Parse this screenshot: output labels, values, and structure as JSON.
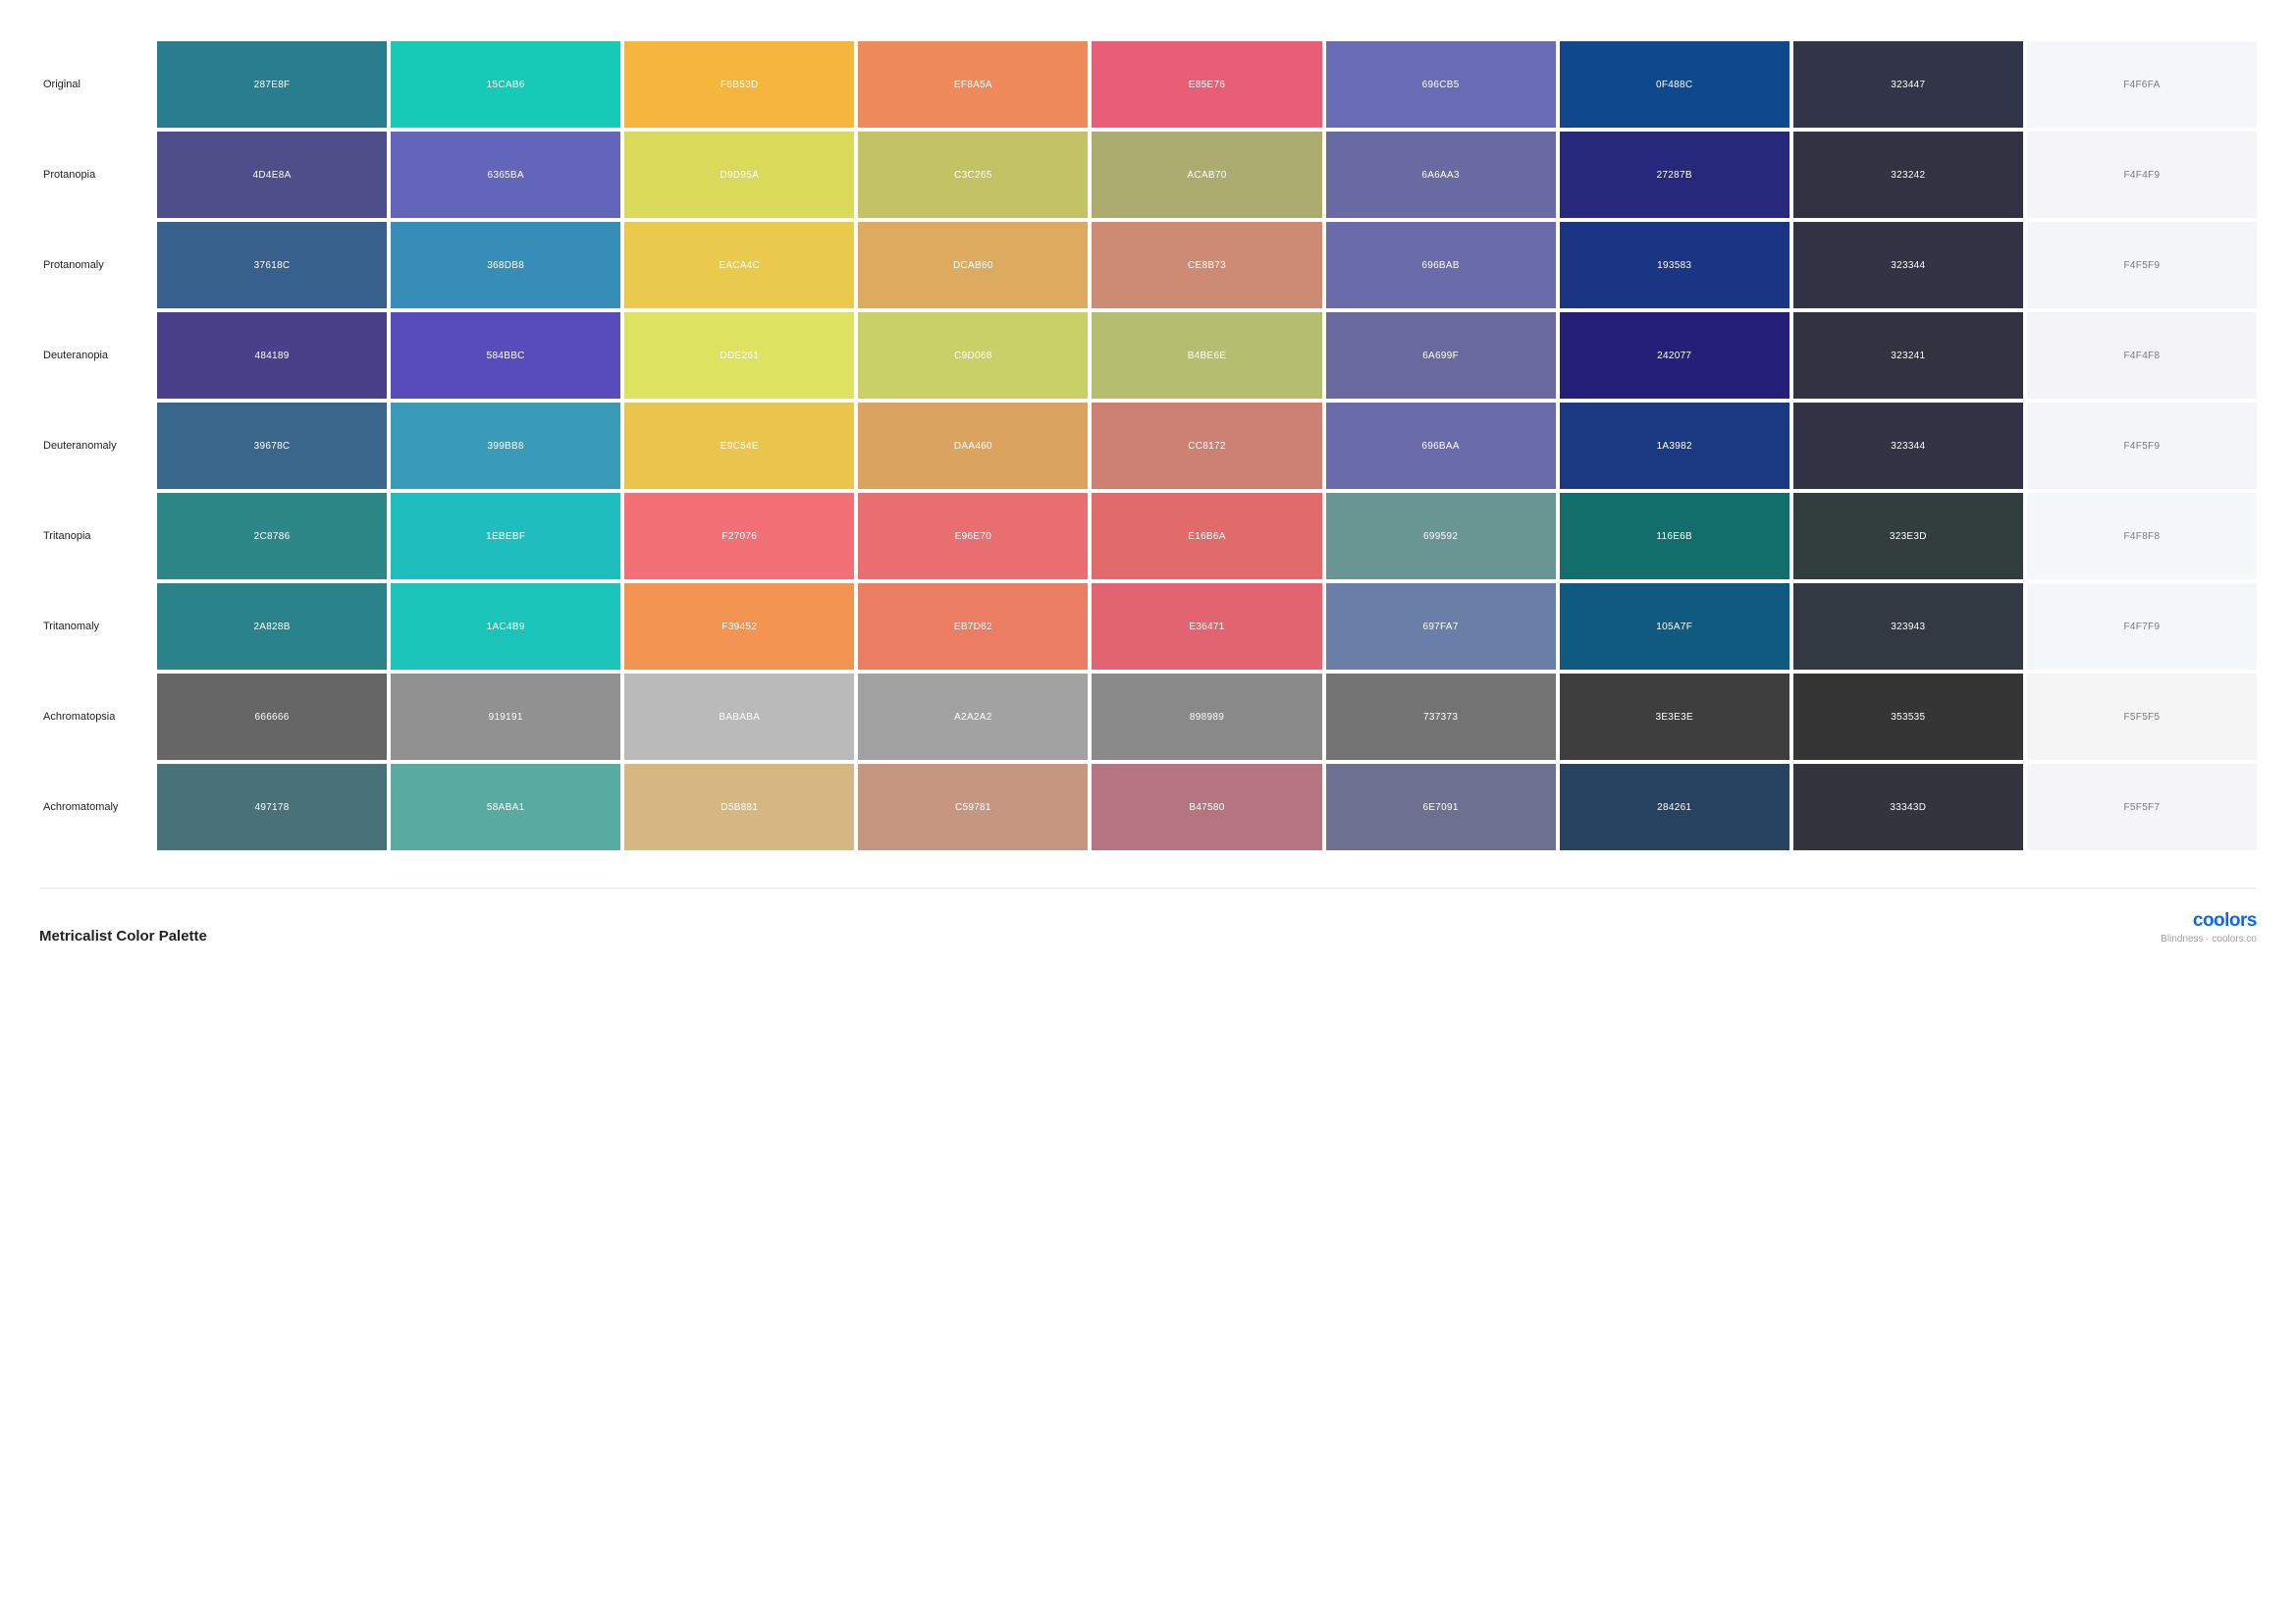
{
  "title": "Metricalist Color Palette",
  "brand": "coolors",
  "brand_sub": "Blindness · coolors.co",
  "rows": [
    {
      "label": "Original",
      "swatches": [
        {
          "hex": "287E8F",
          "text": "light"
        },
        {
          "hex": "15CAB6",
          "text": "light"
        },
        {
          "hex": "F6B53D",
          "text": "light"
        },
        {
          "hex": "EF8A5A",
          "text": "light"
        },
        {
          "hex": "E85E76",
          "text": "light"
        },
        {
          "hex": "696CB5",
          "text": "light"
        },
        {
          "hex": "0F488C",
          "text": "light"
        },
        {
          "hex": "323447",
          "text": "light"
        },
        {
          "hex": "F4F6FA",
          "text": "dark"
        }
      ]
    },
    {
      "label": "Protanopia",
      "swatches": [
        {
          "hex": "4D4E8A",
          "text": "light"
        },
        {
          "hex": "6365BA",
          "text": "light"
        },
        {
          "hex": "D9D95A",
          "text": "light"
        },
        {
          "hex": "C3C265",
          "text": "light"
        },
        {
          "hex": "ACAB70",
          "text": "light"
        },
        {
          "hex": "6A6AA3",
          "text": "light"
        },
        {
          "hex": "27287B",
          "text": "light"
        },
        {
          "hex": "323242",
          "text": "light"
        },
        {
          "hex": "F4F4F9",
          "text": "dark"
        }
      ]
    },
    {
      "label": "Protanomaly",
      "swatches": [
        {
          "hex": "37618C",
          "text": "light"
        },
        {
          "hex": "368DB8",
          "text": "light"
        },
        {
          "hex": "EACA4C",
          "text": "light"
        },
        {
          "hex": "DCAB60",
          "text": "light"
        },
        {
          "hex": "CE8B73",
          "text": "light"
        },
        {
          "hex": "696BAB",
          "text": "light"
        },
        {
          "hex": "193583",
          "text": "light"
        },
        {
          "hex": "323344",
          "text": "light"
        },
        {
          "hex": "F4F5F9",
          "text": "dark"
        }
      ]
    },
    {
      "label": "Deuteranopia",
      "swatches": [
        {
          "hex": "484189",
          "text": "light"
        },
        {
          "hex": "584BBC",
          "text": "light"
        },
        {
          "hex": "DDE261",
          "text": "light"
        },
        {
          "hex": "C9D068",
          "text": "light"
        },
        {
          "hex": "B4BE6E",
          "text": "light"
        },
        {
          "hex": "6A699F",
          "text": "light"
        },
        {
          "hex": "242077",
          "text": "light"
        },
        {
          "hex": "323241",
          "text": "light"
        },
        {
          "hex": "F4F4F8",
          "text": "dark"
        }
      ]
    },
    {
      "label": "Deuteranomaly",
      "swatches": [
        {
          "hex": "39678C",
          "text": "light"
        },
        {
          "hex": "399BB8",
          "text": "light"
        },
        {
          "hex": "E9C54E",
          "text": "light"
        },
        {
          "hex": "DAA460",
          "text": "light"
        },
        {
          "hex": "CC8172",
          "text": "light"
        },
        {
          "hex": "696BAA",
          "text": "light"
        },
        {
          "hex": "1A3982",
          "text": "light"
        },
        {
          "hex": "323344",
          "text": "light"
        },
        {
          "hex": "F4F5F9",
          "text": "dark"
        }
      ]
    },
    {
      "label": "Tritanopia",
      "swatches": [
        {
          "hex": "2C8786",
          "text": "light"
        },
        {
          "hex": "1EBEBF",
          "text": "light"
        },
        {
          "hex": "F27076",
          "text": "light"
        },
        {
          "hex": "E96E70",
          "text": "light"
        },
        {
          "hex": "E16B6A",
          "text": "light"
        },
        {
          "hex": "699592",
          "text": "light"
        },
        {
          "hex": "116E6B",
          "text": "light"
        },
        {
          "hex": "323E3D",
          "text": "light"
        },
        {
          "hex": "F4F8F8",
          "text": "dark"
        }
      ]
    },
    {
      "label": "Tritanomaly",
      "swatches": [
        {
          "hex": "2A828B",
          "text": "light"
        },
        {
          "hex": "1AC4B9",
          "text": "light"
        },
        {
          "hex": "F39452",
          "text": "light"
        },
        {
          "hex": "EB7D62",
          "text": "light"
        },
        {
          "hex": "E36471",
          "text": "light"
        },
        {
          "hex": "697FA7",
          "text": "light"
        },
        {
          "hex": "105A7F",
          "text": "light"
        },
        {
          "hex": "323943",
          "text": "light"
        },
        {
          "hex": "F4F7F9",
          "text": "dark"
        }
      ]
    },
    {
      "label": "Achromatopsia",
      "swatches": [
        {
          "hex": "666666",
          "text": "light"
        },
        {
          "hex": "919191",
          "text": "light"
        },
        {
          "hex": "BABABA",
          "text": "light"
        },
        {
          "hex": "A2A2A2",
          "text": "light"
        },
        {
          "hex": "898989",
          "text": "light"
        },
        {
          "hex": "737373",
          "text": "light"
        },
        {
          "hex": "3E3E3E",
          "text": "light"
        },
        {
          "hex": "353535",
          "text": "light"
        },
        {
          "hex": "F5F5F5",
          "text": "dark"
        }
      ]
    },
    {
      "label": "Achromatomaly",
      "swatches": [
        {
          "hex": "497178",
          "text": "light"
        },
        {
          "hex": "58ABA1",
          "text": "light"
        },
        {
          "hex": "D5B881",
          "text": "light"
        },
        {
          "hex": "C59781",
          "text": "light"
        },
        {
          "hex": "B47580",
          "text": "light"
        },
        {
          "hex": "6E7091",
          "text": "light"
        },
        {
          "hex": "284261",
          "text": "light"
        },
        {
          "hex": "33343D",
          "text": "light"
        },
        {
          "hex": "F5F5F7",
          "text": "dark"
        }
      ]
    }
  ]
}
